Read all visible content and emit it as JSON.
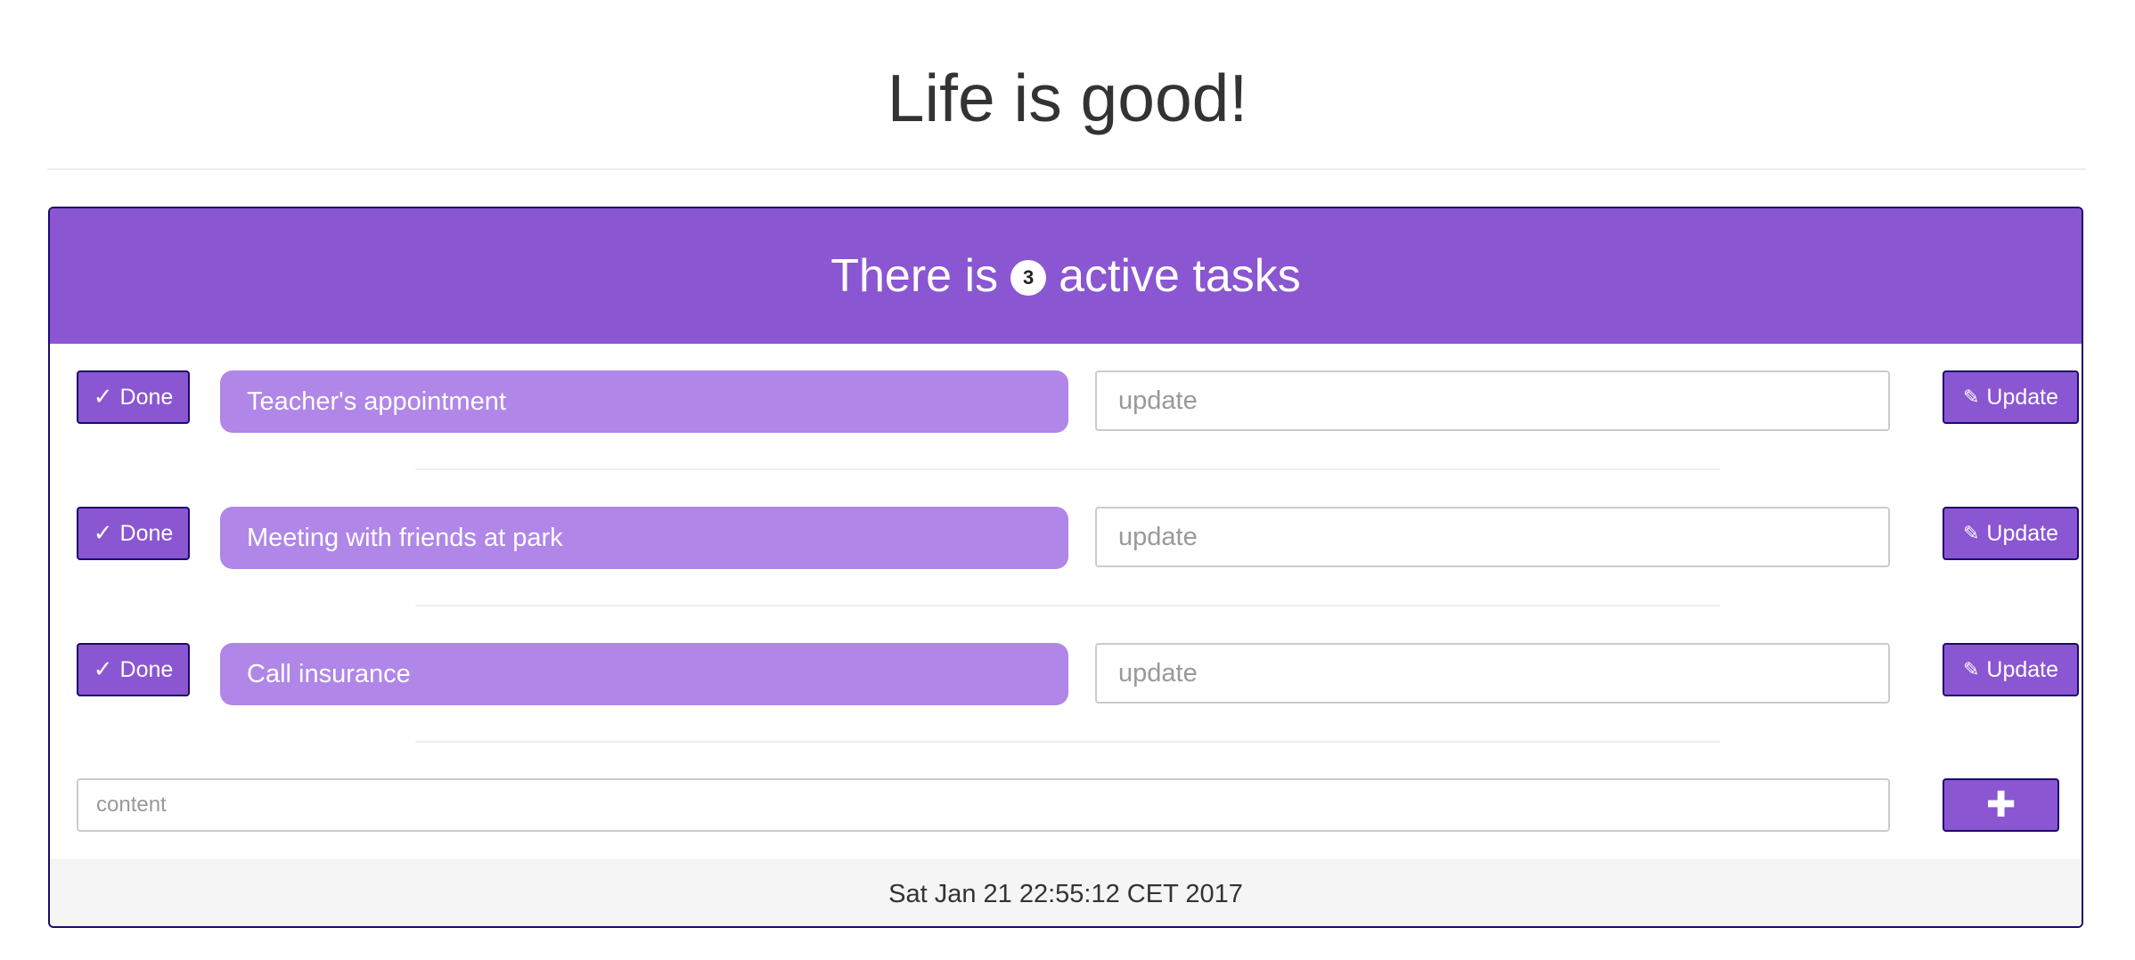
{
  "page": {
    "title": "Life is good!"
  },
  "header": {
    "prefix": "There is",
    "count": "3",
    "suffix": "active tasks"
  },
  "tasks": [
    {
      "done_icon": "✓",
      "done_label": "Done",
      "label": "Teacher's appointment",
      "update_placeholder": "update",
      "update_icon": "✎",
      "update_label": "Update"
    },
    {
      "done_icon": "✓",
      "done_label": "Done",
      "label": "Meeting with friends at park",
      "update_placeholder": "update",
      "update_icon": "✎",
      "update_label": "Update"
    },
    {
      "done_icon": "✓",
      "done_label": "Done",
      "label": "Call insurance",
      "update_placeholder": "update",
      "update_icon": "✎",
      "update_label": "Update"
    }
  ],
  "new_task": {
    "placeholder": "content",
    "add_icon": "✚"
  },
  "footer": {
    "timestamp": "Sat Jan 21 22:55:12 CET 2017"
  },
  "icons": {
    "done": "check-icon",
    "update": "pencil-icon",
    "add": "plus-icon"
  },
  "colors": {
    "accent": "#8a56d1",
    "task_background": "#b086e8",
    "border": "#1c0a6e",
    "footer_background": "#f5f5f5"
  }
}
